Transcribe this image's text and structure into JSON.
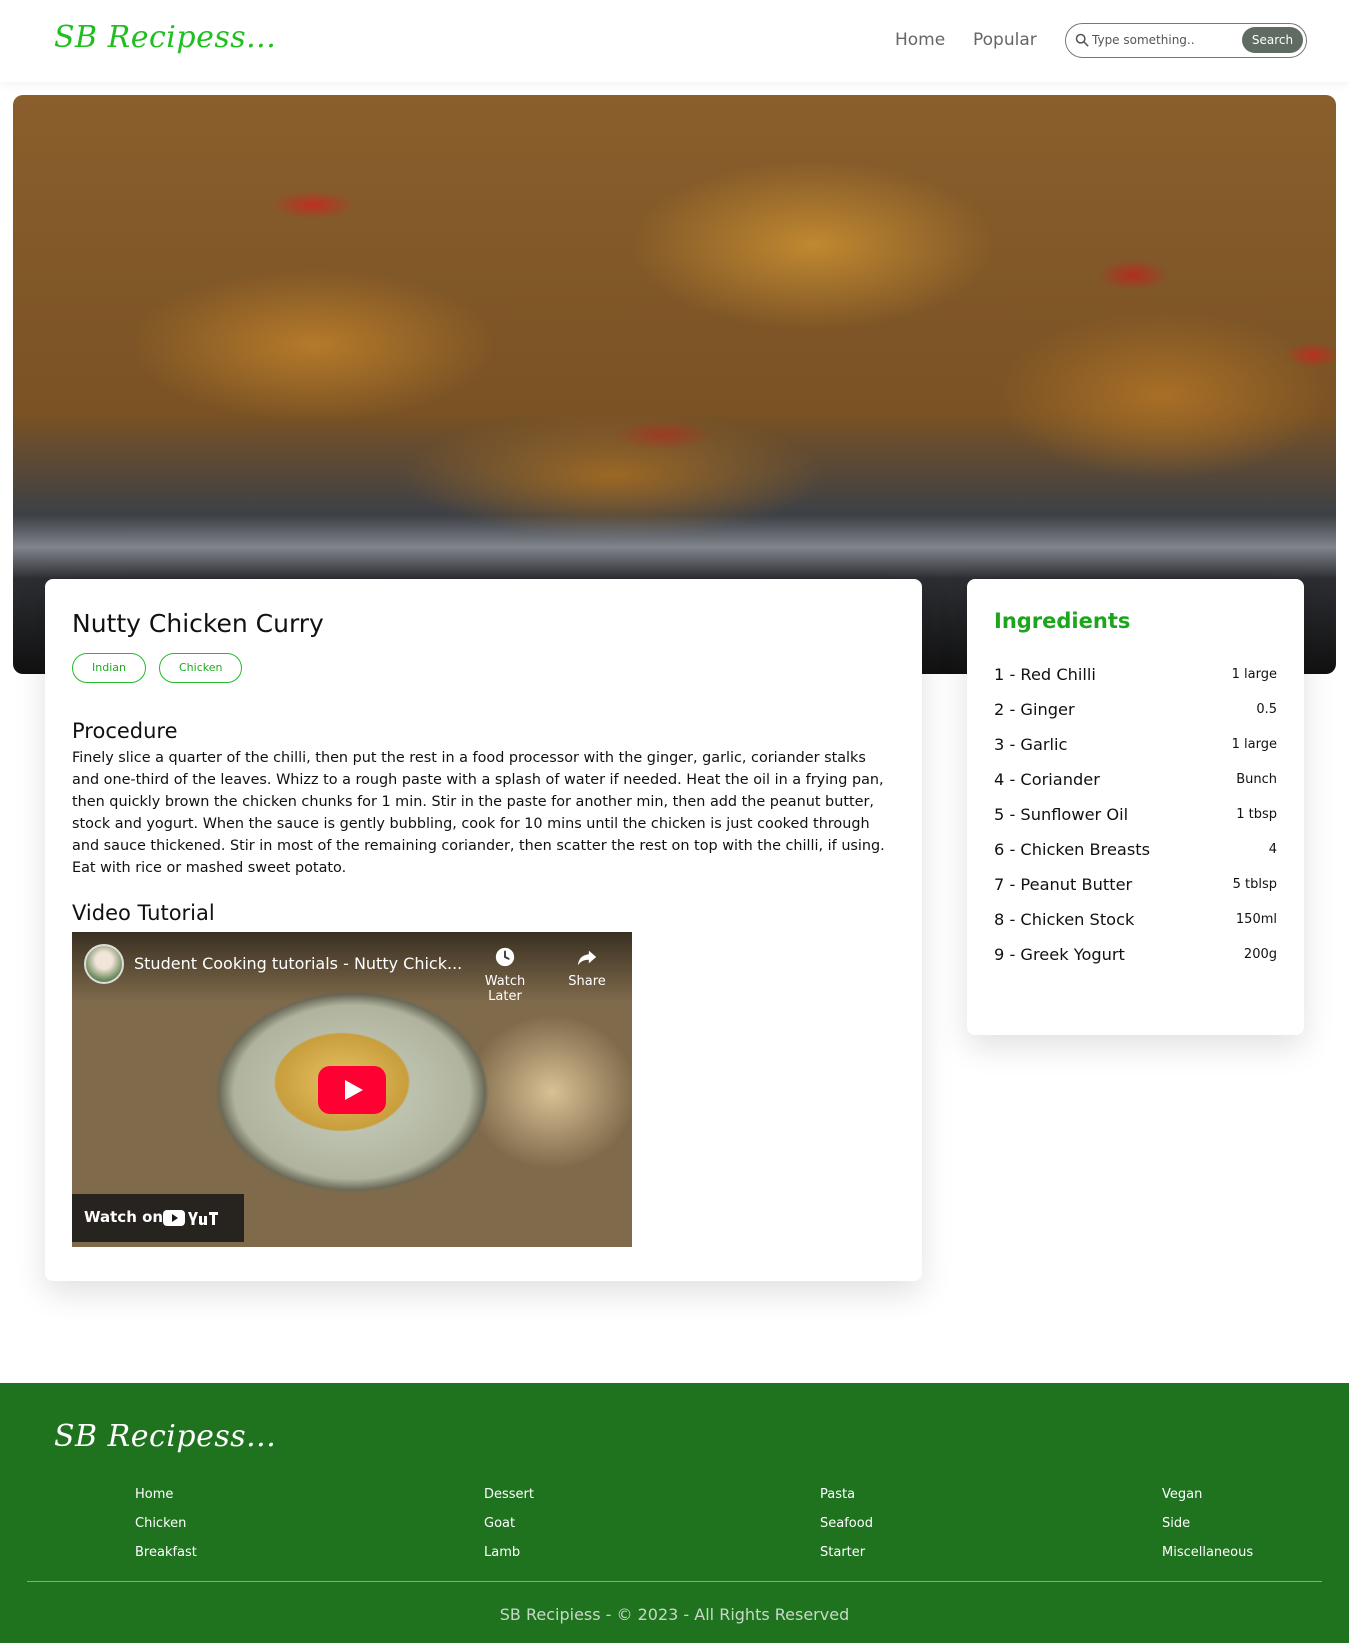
{
  "header": {
    "logo": "SB Recipess...",
    "nav": [
      "Home",
      "Popular"
    ],
    "search_placeholder": "Type something..",
    "search_button": "Search"
  },
  "recipe": {
    "title": "Nutty Chicken Curry",
    "tags": [
      "Indian",
      "Chicken"
    ],
    "procedure_heading": "Procedure",
    "procedure": "Finely slice a quarter of the chilli, then put the rest in a food processor with the ginger, garlic, coriander stalks and one-third of the leaves. Whizz to a rough paste with a splash of water if needed. Heat the oil in a frying pan, then quickly brown the chicken chunks for 1 min. Stir in the paste for another min, then add the peanut butter, stock and yogurt. When the sauce is gently bubbling, cook for 10 mins until the chicken is just cooked through and sauce thickened. Stir in most of the remaining coriander, then scatter the rest on top with the chilli, if using. Eat with rice or mashed sweet potato.",
    "video_heading": "Video Tutorial"
  },
  "video": {
    "title": "Student Cooking tutorials - Nutty Chick...",
    "watch_later": "Watch Later",
    "share": "Share",
    "watch_on": "Watch on",
    "play_icon": "play-icon"
  },
  "ingredients": {
    "title": "Ingredients",
    "items": [
      {
        "name": "1 - Red Chilli",
        "qty": "1 large"
      },
      {
        "name": "2 - Ginger",
        "qty": "0.5"
      },
      {
        "name": "3 - Garlic",
        "qty": "1 large"
      },
      {
        "name": "4 - Coriander",
        "qty": "Bunch"
      },
      {
        "name": "5 - Sunflower Oil",
        "qty": "1 tbsp"
      },
      {
        "name": "6 - Chicken Breasts",
        "qty": "4"
      },
      {
        "name": "7 - Peanut Butter",
        "qty": "5 tblsp"
      },
      {
        "name": "8 - Chicken Stock",
        "qty": "150ml"
      },
      {
        "name": "9 - Greek Yogurt",
        "qty": "200g"
      }
    ]
  },
  "footer": {
    "logo": "SB Recipess...",
    "columns": [
      [
        "Home",
        "Chicken",
        "Breakfast"
      ],
      [
        "Dessert",
        "Goat",
        "Lamb"
      ],
      [
        "Pasta",
        "Seafood",
        "Starter"
      ],
      [
        "Vegan",
        "Side",
        "Miscellaneous"
      ]
    ],
    "copyright": "SB Recipiess - © 2023 - All Rights Reserved"
  },
  "colors": {
    "brand_green": "#1fbf1f",
    "footer_bg": "#1f731f",
    "search_button_bg": "#606b64",
    "play_red": "#ff0033"
  }
}
